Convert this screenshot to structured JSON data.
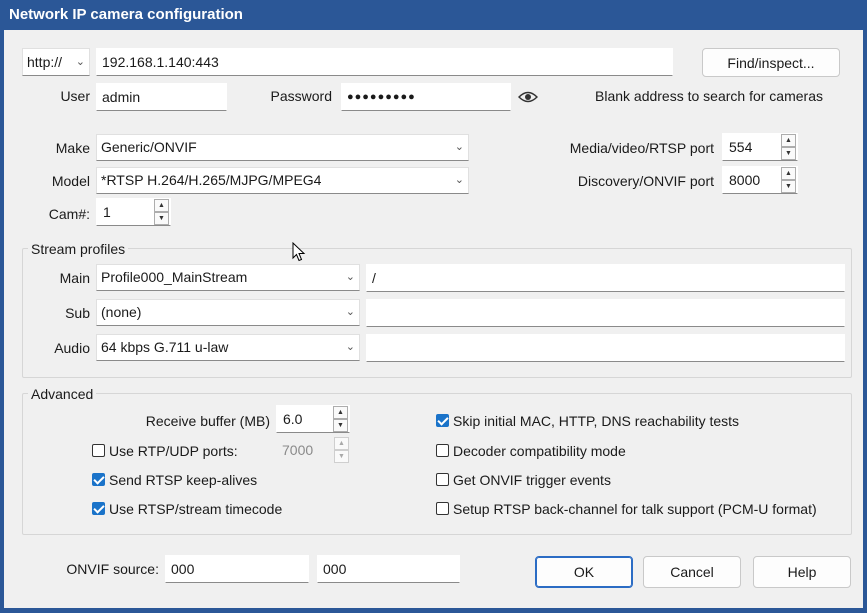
{
  "window": {
    "title": "Network IP camera configuration"
  },
  "address": {
    "protocol": "http://",
    "value": "192.168.1.140:443",
    "find_button": "Find/inspect..."
  },
  "credentials": {
    "user_label": "User",
    "user_value": "admin",
    "password_label": "Password",
    "password_mask": "●●●●●●●●●",
    "eye_icon": "eye-icon",
    "hint": "Blank address to search for cameras"
  },
  "device": {
    "make_label": "Make",
    "make_value": "Generic/ONVIF",
    "model_label": "Model",
    "model_value": "*RTSP H.264/H.265/MJPG/MPEG4",
    "cam_label": "Cam#:",
    "cam_value": "1",
    "media_port_label": "Media/video/RTSP port",
    "media_port_value": "554",
    "discovery_port_label": "Discovery/ONVIF port",
    "discovery_port_value": "8000"
  },
  "stream_profiles": {
    "title": "Stream profiles",
    "main_label": "Main",
    "main_value": "Profile000_MainStream",
    "main_path": "/",
    "sub_label": "Sub",
    "sub_value": "(none)",
    "sub_path": "",
    "audio_label": "Audio",
    "audio_value": "64 kbps G.711 u-law",
    "audio_path": ""
  },
  "advanced": {
    "title": "Advanced",
    "receive_buffer_label": "Receive buffer (MB)",
    "receive_buffer_value": "6.0",
    "rtp_udp_label": "Use RTP/UDP ports:",
    "rtp_udp_checked": false,
    "rtp_udp_value": "7000",
    "keepalive_label": "Send RTSP keep-alives",
    "keepalive_checked": true,
    "timecode_label": "Use RTSP/stream timecode",
    "timecode_checked": true,
    "skip_tests_label": "Skip initial MAC, HTTP, DNS reachability tests",
    "skip_tests_checked": true,
    "decoder_compat_label": "Decoder compatibility mode",
    "decoder_compat_checked": false,
    "onvif_events_label": "Get ONVIF trigger events",
    "onvif_events_checked": false,
    "backchannel_label": "Setup RTSP back-channel for talk support (PCM-U format)",
    "backchannel_checked": false
  },
  "footer": {
    "onvif_source_label": "ONVIF source:",
    "onvif_source_1": "000",
    "onvif_source_2": "000",
    "ok": "OK",
    "cancel": "Cancel",
    "help": "Help"
  },
  "colors": {
    "titlebar": "#2b5797",
    "checkbox_on": "#1a73c9",
    "dialog_bg": "#f0f0f0"
  }
}
